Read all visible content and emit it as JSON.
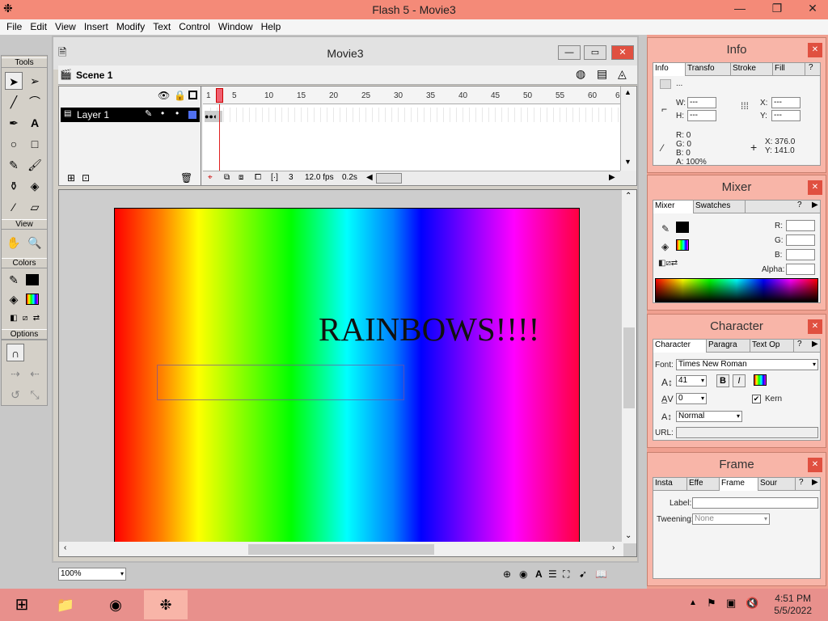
{
  "window": {
    "title": "Flash 5 - Movie3",
    "minimize": "—",
    "maximize": "❐",
    "close": "✕"
  },
  "menu": [
    "File",
    "Edit",
    "View",
    "Insert",
    "Modify",
    "Text",
    "Control",
    "Window",
    "Help"
  ],
  "tools": {
    "header": "Tools",
    "view_header": "View",
    "colors_header": "Colors",
    "options_header": "Options"
  },
  "movie": {
    "title": "Movie3",
    "scene": "Scene 1",
    "layer": "Layer 1",
    "ruler_ticks": [
      "1",
      "5",
      "10",
      "15",
      "20",
      "25",
      "30",
      "35",
      "40",
      "45",
      "50",
      "55",
      "60",
      "6"
    ],
    "current_frame": "3",
    "fps": "12.0 fps",
    "elapsed": "0.2s",
    "zoom": "100%",
    "stage_text": "RAINBOWS!!!!"
  },
  "info_panel": {
    "title": "Info",
    "tabs": [
      "Info",
      "Transfo",
      "Stroke",
      "Fill"
    ],
    "w_label": "W:",
    "w_value": "---",
    "h_label": "H:",
    "h_value": "---",
    "x_label": "X:",
    "x_value": "---",
    "y_label": "Y:",
    "y_value": "---",
    "r": "R: 0",
    "g": "G: 0",
    "b": "B: 0",
    "a": "A: 100%",
    "cursor_x": "X:  376.0",
    "cursor_y": "Y:  141.0",
    "dots": "..."
  },
  "mixer_panel": {
    "title": "Mixer",
    "tabs": [
      "Mixer",
      "Swatches"
    ],
    "r_label": "R:",
    "g_label": "G:",
    "b_label": "B:",
    "alpha_label": "Alpha:"
  },
  "character_panel": {
    "title": "Character",
    "tabs": [
      "Character",
      "Paragra",
      "Text Op"
    ],
    "font_label": "Font:",
    "font": "Times New Roman",
    "size": "41",
    "tracking": "0",
    "kern_label": "Kern",
    "baseline": "Normal",
    "url_label": "URL:",
    "bold": "B",
    "italic": "I"
  },
  "frame_panel": {
    "title": "Frame",
    "tabs": [
      "Insta",
      "Effe",
      "Frame",
      "Sour"
    ],
    "label_label": "Label:",
    "tweening_label": "Tweening:",
    "tweening": "None"
  },
  "taskbar": {
    "time": "4:51 PM",
    "date": "5/5/2022"
  },
  "colors": {
    "titlebar": "#f48a78",
    "panel": "#f8b5a8",
    "taskbar": "#e8908c"
  }
}
